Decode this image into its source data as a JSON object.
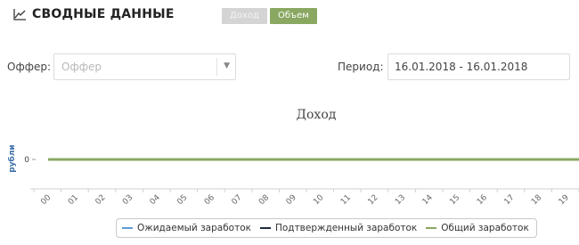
{
  "header": {
    "title": "СВОДНЫЕ ДАННЫЕ",
    "toggle_income": "Доход",
    "toggle_volume": "Объем"
  },
  "filters": {
    "offer_label": "Оффер:",
    "offer_placeholder": "Оффер",
    "period_label": "Период:",
    "period_value": "16.01.2018 - 16.01.2018"
  },
  "chart_data": {
    "type": "line",
    "title": "Доход",
    "xlabel": "",
    "ylabel": "рубли",
    "categories": [
      "00",
      "01",
      "02",
      "03",
      "04",
      "05",
      "06",
      "07",
      "08",
      "09",
      "10",
      "11",
      "12",
      "13",
      "14",
      "15",
      "16",
      "17",
      "18",
      "19"
    ],
    "series": [
      {
        "name": "Ожидаемый заработок",
        "color": "#5b9bd5",
        "values": [
          0,
          0,
          0,
          0,
          0,
          0,
          0,
          0,
          0,
          0,
          0,
          0,
          0,
          0,
          0,
          0,
          0,
          0,
          0,
          0
        ]
      },
      {
        "name": "Подтвержденный заработок",
        "color": "#1e2b3c",
        "values": [
          0,
          0,
          0,
          0,
          0,
          0,
          0,
          0,
          0,
          0,
          0,
          0,
          0,
          0,
          0,
          0,
          0,
          0,
          0,
          0
        ]
      },
      {
        "name": "Общий заработок",
        "color": "#8aa862",
        "values": [
          0,
          0,
          0,
          0,
          0,
          0,
          0,
          0,
          0,
          0,
          0,
          0,
          0,
          0,
          0,
          0,
          0,
          0,
          0,
          0
        ]
      }
    ],
    "y_ticks": [
      "0"
    ],
    "grid": false,
    "legend_position": "bottom-center"
  }
}
